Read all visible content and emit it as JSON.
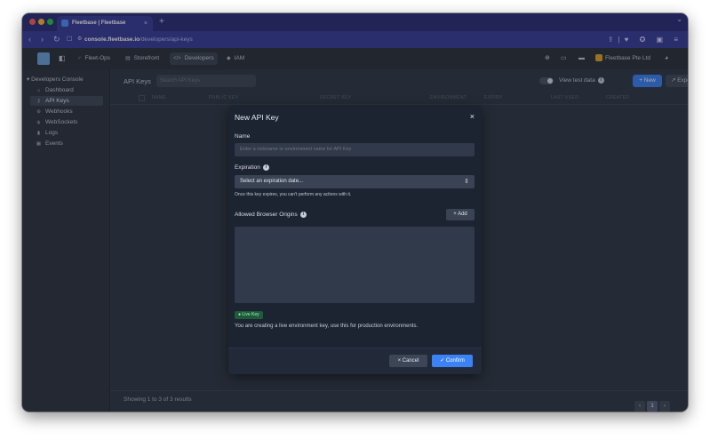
{
  "browser": {
    "tab_title": "Fleetbase | Fleetbase",
    "tab_close": "×",
    "new_tab": "+",
    "url_host": "console.fleetbase.io",
    "url_path": "/developers/api-keys",
    "colors": {
      "tabstrip": "#2b2d7a",
      "address_bar": "#3a3d9a"
    }
  },
  "header": {
    "nav": [
      {
        "label": "Fleet-Ops",
        "icon": "route-icon"
      },
      {
        "label": "Storefront",
        "icon": "store-icon"
      },
      {
        "label": "Developers",
        "icon": "code-icon"
      },
      {
        "label": "IAM",
        "icon": "shield-icon"
      }
    ],
    "org_name": "Fleetbase Pte Ltd"
  },
  "sidebar": {
    "heading": "Developers Console",
    "items": [
      {
        "label": "Dashboard",
        "icon": "home-icon"
      },
      {
        "label": "API Keys",
        "icon": "key-icon"
      },
      {
        "label": "Webhooks",
        "icon": "webhook-icon"
      },
      {
        "label": "WebSockets",
        "icon": "plug-icon"
      },
      {
        "label": "Logs",
        "icon": "file-icon"
      },
      {
        "label": "Events",
        "icon": "list-icon"
      }
    ]
  },
  "main": {
    "title": "API Keys",
    "search_placeholder": "Search API Keys",
    "view_test_data": "View test data",
    "new_label": "+ New",
    "export_label": "↗ Export",
    "columns": [
      "NAME",
      "PUBLIC KEY",
      "SECRET KEY",
      "ENVIRONMENT",
      "EXPIRY",
      "LAST USED",
      "CREATED"
    ],
    "showing": "Showing 1 to 3 of 3 results",
    "pager": {
      "prev": "‹",
      "current": "1",
      "next": "›"
    }
  },
  "modal": {
    "title": "New API Key",
    "close": "×",
    "name_label": "Name",
    "name_placeholder": "Enter a nickname or environment name for API Key",
    "expiration_label": "Expiration",
    "expiration_value": "Select an expiration date...",
    "expiration_hint": "Once this key expires, you can't perform any actions with it.",
    "origins_label": "Allowed Browser Origins",
    "add_label": "+ Add",
    "badge": "Live Key",
    "live_text": "You are creating a live environment key, use this for production environments.",
    "cancel_label": "Cancel",
    "confirm_label": "Confirm",
    "colors": {
      "primary": "#3b82f6",
      "live_badge": "#1f5b3a"
    }
  }
}
